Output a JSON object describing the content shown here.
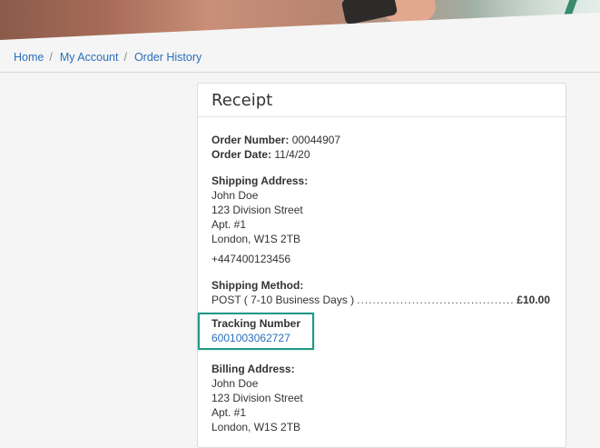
{
  "breadcrumb": [
    {
      "label": "Home"
    },
    {
      "label": "My Account"
    },
    {
      "label": "Order History"
    }
  ],
  "receipt": {
    "title": "Receipt",
    "order_number_label": "Order Number:",
    "order_number": "00044907",
    "order_date_label": "Order Date:",
    "order_date": "11/4/20",
    "shipping_address_label": "Shipping Address:",
    "shipping_address": [
      "John Doe",
      "123 Division Street",
      "Apt. #1",
      "London, W1S 2TB"
    ],
    "phone": "+447400123456",
    "shipping_method_label": "Shipping Method:",
    "shipping_method": "POST ( 7-10 Business Days )",
    "shipping_dots": "................................................................................",
    "shipping_price": "£10.00",
    "tracking_label": "Tracking Number",
    "tracking_number": "6001003062727",
    "billing_address_label": "Billing Address:",
    "billing_address": [
      "John Doe",
      "123 Division Street",
      "Apt. #1",
      "London, W1S 2TB"
    ]
  },
  "colors": {
    "link": "#2a6ebb",
    "highlight_border": "#1f9a85"
  }
}
